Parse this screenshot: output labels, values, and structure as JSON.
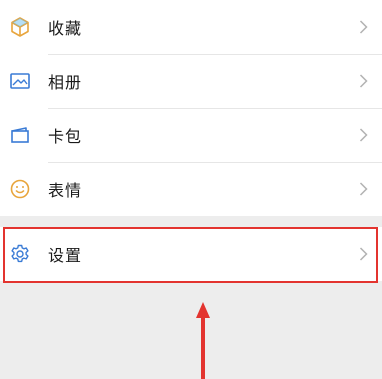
{
  "menu": {
    "items": [
      {
        "label": "收藏",
        "icon": "cube-icon",
        "icon_color": "#e8a53c"
      },
      {
        "label": "相册",
        "icon": "image-icon",
        "icon_color": "#3a7bd5"
      },
      {
        "label": "卡包",
        "icon": "card-icon",
        "icon_color": "#3a7bd5"
      },
      {
        "label": "表情",
        "icon": "smiley-icon",
        "icon_color": "#e8a53c"
      }
    ],
    "settings": {
      "label": "设置",
      "icon": "gear-icon",
      "icon_color": "#3a7bd5"
    }
  },
  "annotation": {
    "highlight_color": "#e3342f",
    "arrow_color": "#e3342f"
  },
  "colors": {
    "background": "#ededed",
    "row_background": "#ffffff",
    "chevron": "#b2b2b2",
    "text": "#1a1a1a"
  }
}
